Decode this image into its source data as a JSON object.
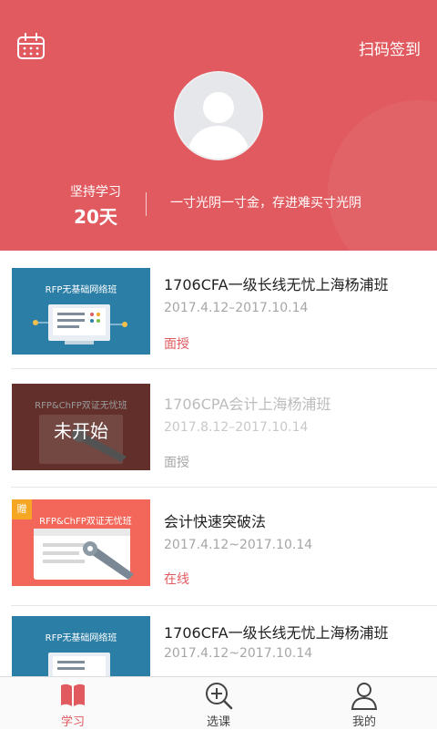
{
  "header": {
    "scan_checkin": "扫码签到",
    "streak_label": "坚持学习",
    "streak_value": "20天",
    "motto": "一寸光阴一寸金，存进难买寸光阴",
    "bg_color": "#e05a5f"
  },
  "courses": [
    {
      "thumb_text": "RFP无基础网络班",
      "title": "1706CFA一级长线无忧上海杨浦班",
      "date": "2017.4.12–2017.10.14",
      "tag": "面授",
      "status": "active"
    },
    {
      "thumb_text": "RFP&ChFP双证无忧班",
      "overlay_label": "未开始",
      "title": "1706CPA会计上海杨浦班",
      "date": "2017.8.12–2017.10.14",
      "tag": "面授",
      "status": "not-started"
    },
    {
      "badge": "赠",
      "thumb_text": "RFP&ChFP双证无忧班",
      "title": "会计快速突破法",
      "date": "2017.4.12~2017.10.14",
      "tag": "在线",
      "status": "active"
    },
    {
      "thumb_text": "RFP无基础网络班",
      "title": "1706CFA一级长线无忧上海杨浦班",
      "date": "2017.4.12~2017.10.14",
      "tag": "",
      "status": "active"
    }
  ],
  "tabbar": {
    "tabs": [
      {
        "label": "学习",
        "icon": "book-icon",
        "active": true
      },
      {
        "label": "选课",
        "icon": "search-plus-icon",
        "active": false
      },
      {
        "label": "我的",
        "icon": "user-icon",
        "active": false
      }
    ],
    "active_color": "#e05a5f"
  }
}
